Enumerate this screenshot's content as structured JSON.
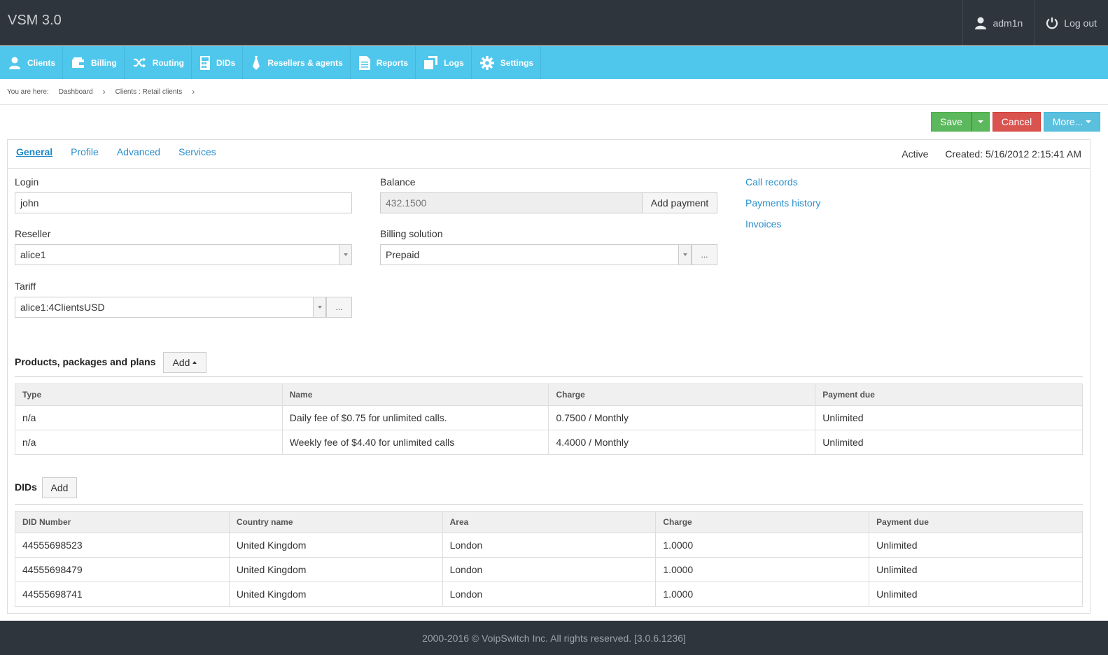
{
  "header": {
    "brand": "VSM 3.0",
    "user": "adm1n",
    "logout": "Log out"
  },
  "nav": [
    {
      "label": "Clients",
      "icon": "user-icon"
    },
    {
      "label": "Billing",
      "icon": "wallet-icon"
    },
    {
      "label": "Routing",
      "icon": "shuffle-icon"
    },
    {
      "label": "DIDs",
      "icon": "phone-grid-icon"
    },
    {
      "label": "Resellers & agents",
      "icon": "tie-icon"
    },
    {
      "label": "Reports",
      "icon": "document-icon"
    },
    {
      "label": "Logs",
      "icon": "copy-icon"
    },
    {
      "label": "Settings",
      "icon": "gear-icon"
    }
  ],
  "breadcrumb": {
    "prefix": "You are here:",
    "items": [
      "Dashboard",
      "Clients : Retail clients"
    ]
  },
  "actions": {
    "save": "Save",
    "cancel": "Cancel",
    "more": "More..."
  },
  "tabs": [
    "General",
    "Profile",
    "Advanced",
    "Services"
  ],
  "status": {
    "state": "Active",
    "created": "Created: 5/16/2012 2:15:41 AM"
  },
  "form": {
    "login_label": "Login",
    "login_value": "john",
    "reseller_label": "Reseller",
    "reseller_value": "alice1",
    "tariff_label": "Tariff",
    "tariff_value": "alice1:4ClientsUSD",
    "balance_label": "Balance",
    "balance_value": "432.1500",
    "add_payment": "Add payment",
    "billing_label": "Billing solution",
    "billing_value": "Prepaid",
    "dots": "..."
  },
  "links": [
    "Call records",
    "Payments history",
    "Invoices"
  ],
  "products": {
    "title": "Products, packages and plans",
    "add": "Add",
    "columns": [
      "Type",
      "Name",
      "Charge",
      "Payment due"
    ],
    "rows": [
      [
        "n/a",
        "Daily fee of $0.75 for unlimited calls.",
        "0.7500 / Monthly",
        "Unlimited"
      ],
      [
        "n/a",
        "Weekly fee of $4.40 for unlimited calls",
        "4.4000 / Monthly",
        "Unlimited"
      ]
    ]
  },
  "dids": {
    "title": "DIDs",
    "add": "Add",
    "columns": [
      "DID Number",
      "Country name",
      "Area",
      "Charge",
      "Payment due"
    ],
    "rows": [
      [
        "44555698523",
        "United Kingdom",
        "London",
        "1.0000",
        "Unlimited"
      ],
      [
        "44555698479",
        "United Kingdom",
        "London",
        "1.0000",
        "Unlimited"
      ],
      [
        "44555698741",
        "United Kingdom",
        "London",
        "1.0000",
        "Unlimited"
      ]
    ]
  },
  "footer": "2000-2016 © VoipSwitch Inc. All rights reserved. [3.0.6.1236]"
}
